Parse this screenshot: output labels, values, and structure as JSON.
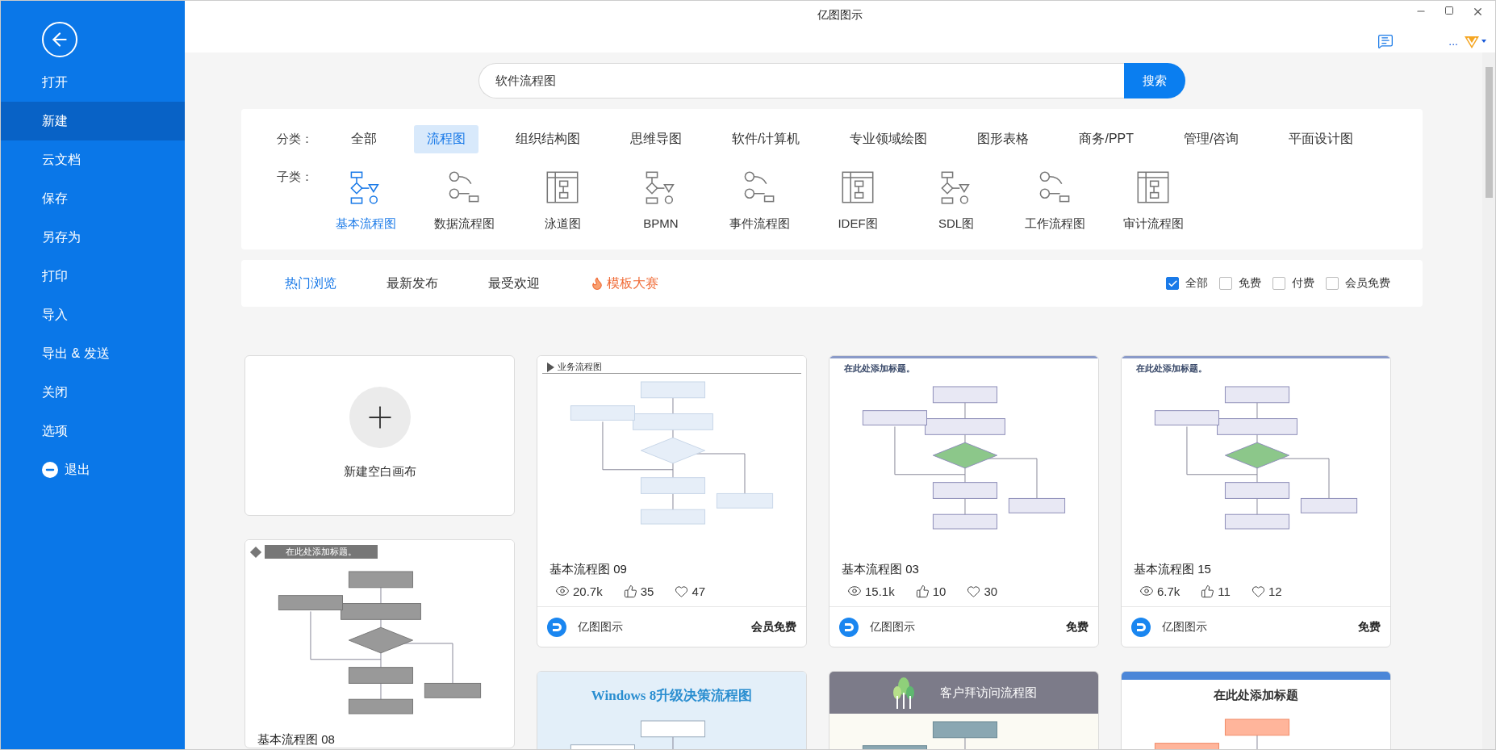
{
  "window": {
    "title": "亿图图示",
    "more": "..."
  },
  "sidebar": {
    "items": [
      {
        "label": "打开",
        "selected": false
      },
      {
        "label": "新建",
        "selected": true
      },
      {
        "label": "云文档",
        "selected": false
      },
      {
        "label": "保存",
        "selected": false
      },
      {
        "label": "另存为",
        "selected": false
      },
      {
        "label": "打印",
        "selected": false
      },
      {
        "label": "导入",
        "selected": false
      },
      {
        "label": "导出 & 发送",
        "selected": false
      },
      {
        "label": "关闭",
        "selected": false
      },
      {
        "label": "选项",
        "selected": false
      },
      {
        "label": "退出",
        "selected": false,
        "kind": "exit"
      }
    ]
  },
  "search": {
    "value": "软件流程图",
    "button": "搜索"
  },
  "categories": {
    "label": "分类：",
    "items": [
      {
        "label": "全部",
        "selected": false
      },
      {
        "label": "流程图",
        "selected": true
      },
      {
        "label": "组织结构图",
        "selected": false
      },
      {
        "label": "思维导图",
        "selected": false
      },
      {
        "label": "软件/计算机",
        "selected": false
      },
      {
        "label": "专业领域绘图",
        "selected": false
      },
      {
        "label": "图形表格",
        "selected": false
      },
      {
        "label": "商务/PPT",
        "selected": false
      },
      {
        "label": "管理/咨询",
        "selected": false
      },
      {
        "label": "平面设计图",
        "selected": false
      }
    ]
  },
  "subcategories": {
    "label": "子类：",
    "items": [
      {
        "label": "基本流程图",
        "selected": true
      },
      {
        "label": "数据流程图",
        "selected": false
      },
      {
        "label": "泳道图",
        "selected": false
      },
      {
        "label": "BPMN",
        "selected": false
      },
      {
        "label": "事件流程图",
        "selected": false
      },
      {
        "label": "IDEF图",
        "selected": false
      },
      {
        "label": "SDL图",
        "selected": false
      },
      {
        "label": "工作流程图",
        "selected": false
      },
      {
        "label": "审计流程图",
        "selected": false
      }
    ]
  },
  "sort_tabs": [
    {
      "label": "热门浏览",
      "selected": true,
      "kind": "normal"
    },
    {
      "label": "最新发布",
      "selected": false,
      "kind": "normal"
    },
    {
      "label": "最受欢迎",
      "selected": false,
      "kind": "normal"
    },
    {
      "label": "模板大赛",
      "selected": false,
      "kind": "contest"
    }
  ],
  "filters": [
    {
      "label": "全部",
      "checked": true
    },
    {
      "label": "免费",
      "checked": false
    },
    {
      "label": "付费",
      "checked": false
    },
    {
      "label": "会员免费",
      "checked": false
    }
  ],
  "columns": [
    [
      {
        "kind": "blank",
        "label": "新建空白画布"
      },
      {
        "kind": "template",
        "thumb": {
          "kind": "gray",
          "heading": "在此处添加标题。"
        },
        "name": "基本流程图 08"
      }
    ],
    [
      {
        "kind": "template",
        "thumb": {
          "kind": "plain",
          "heading": "业务流程图"
        },
        "name": "基本流程图 09",
        "views": "20.7k",
        "likes": "35",
        "favorites": "47",
        "author": "亿图图示",
        "price": "会员免费"
      },
      {
        "kind": "template",
        "thumb": {
          "kind": "banner",
          "heading": "Windows 8升级决策流程图"
        }
      }
    ],
    [
      {
        "kind": "template",
        "thumb": {
          "kind": "titled",
          "heading": "在此处添加标题。"
        },
        "name": "基本流程图 03",
        "views": "15.1k",
        "likes": "10",
        "favorites": "30",
        "author": "亿图图示",
        "price": "免费"
      },
      {
        "kind": "template",
        "thumb": {
          "kind": "dark",
          "heading": "客户拜访问流程图"
        }
      }
    ],
    [
      {
        "kind": "template",
        "thumb": {
          "kind": "titled",
          "heading": "在此处添加标题。"
        },
        "name": "基本流程图 15",
        "views": "6.7k",
        "likes": "11",
        "favorites": "12",
        "author": "亿图图示",
        "price": "免费"
      },
      {
        "kind": "template",
        "thumb": {
          "kind": "bluetop",
          "heading": "在此处添加标题"
        }
      }
    ]
  ]
}
